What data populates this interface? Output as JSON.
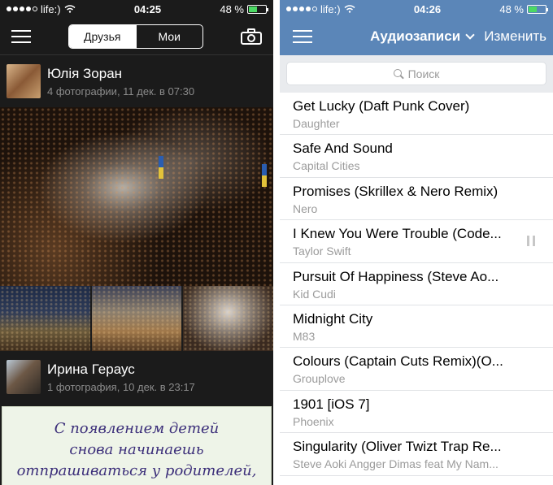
{
  "left_phone": {
    "status": {
      "carrier": "life:)",
      "time": "04:25",
      "battery": "48 %",
      "battery_level": 0.48
    },
    "nav": {
      "tabs": [
        {
          "label": "Друзья",
          "selected": true
        },
        {
          "label": "Мои",
          "selected": false
        }
      ]
    },
    "posts": [
      {
        "name": "Юлія Зоран",
        "meta": "4 фотографии, 11 дек. в 07:30"
      },
      {
        "name": "Ирина Гераус",
        "meta": "1 фотография, 10 дек. в 23:17"
      }
    ],
    "note_lines": [
      "С появлением детей",
      "снова начинаешь",
      "отпрашиваться у родителей,"
    ]
  },
  "right_phone": {
    "status": {
      "carrier": "life:)",
      "time": "04:26",
      "battery": "48 %",
      "battery_level": 0.48
    },
    "nav": {
      "title": "Аудиозаписи",
      "edit_label": "Изменить"
    },
    "search": {
      "placeholder": "Поиск"
    },
    "tracks": [
      {
        "title": "Get Lucky (Daft Punk Cover)",
        "artist": "Daughter"
      },
      {
        "title": "Safe And Sound",
        "artist": "Capital Cities"
      },
      {
        "title": "Promises (Skrillex & Nero Remix)",
        "artist": "Nero"
      },
      {
        "title": "I Knew You Were Trouble (Code...",
        "artist": "Taylor Swift",
        "playing": true
      },
      {
        "title": "Pursuit Of Happiness (Steve Ao...",
        "artist": "Kid Cudi"
      },
      {
        "title": "Midnight City",
        "artist": "M83"
      },
      {
        "title": "Colours (Captain Cuts Remix)(O...",
        "artist": "Grouplove"
      },
      {
        "title": "1901 [iOS 7]",
        "artist": "Phoenix"
      },
      {
        "title": "Singularity (Oliver Twizt Trap Re...",
        "artist": "Steve Aoki Angger Dimas feat My Nam..."
      }
    ]
  },
  "colors": {
    "vk_blue": "#5b86b8",
    "dark_bg": "#1b1b1b",
    "meta_gray": "#8b8b8b",
    "battery_green": "#4cd964"
  }
}
